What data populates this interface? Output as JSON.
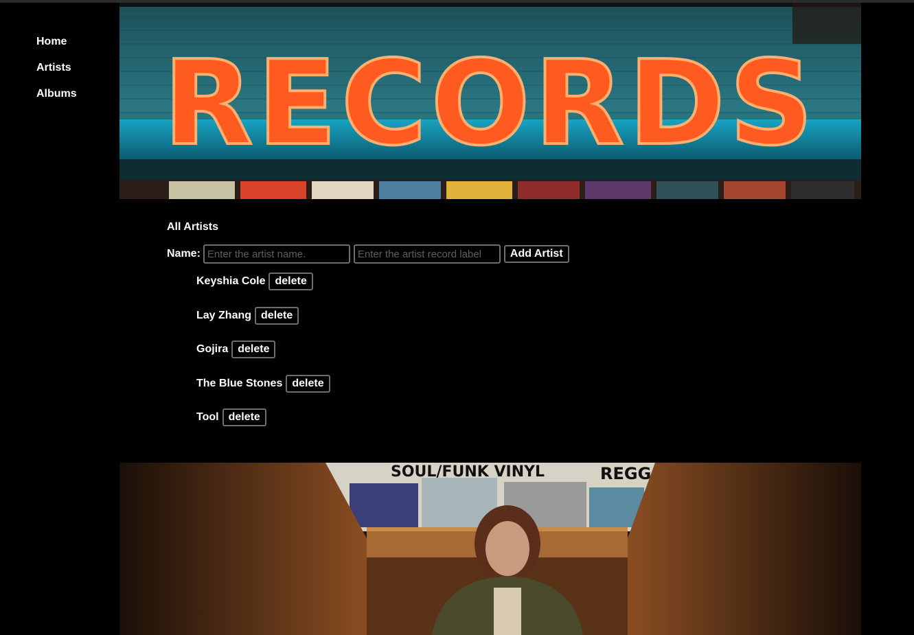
{
  "nav": {
    "items": [
      {
        "label": "Home"
      },
      {
        "label": "Artists"
      },
      {
        "label": "Albums"
      }
    ]
  },
  "banner": {
    "sign_text": "RECORDS",
    "sign_color": "#ff5a1f",
    "wall_color": "#236b76"
  },
  "main": {
    "title": "All Artists",
    "form": {
      "name_label": "Name:",
      "name_placeholder": "Enter the artist name.",
      "label_placeholder": "Enter the artist record label",
      "add_button": "Add Artist"
    },
    "delete_label": "delete",
    "artists": [
      {
        "name": "Keyshia Cole"
      },
      {
        "name": "Lay Zhang"
      },
      {
        "name": "Gojira"
      },
      {
        "name": "The Blue Stones"
      },
      {
        "name": "Tool"
      }
    ]
  },
  "photo": {
    "signs": [
      "SOUL/FUNK VINYL",
      "REGG"
    ]
  }
}
